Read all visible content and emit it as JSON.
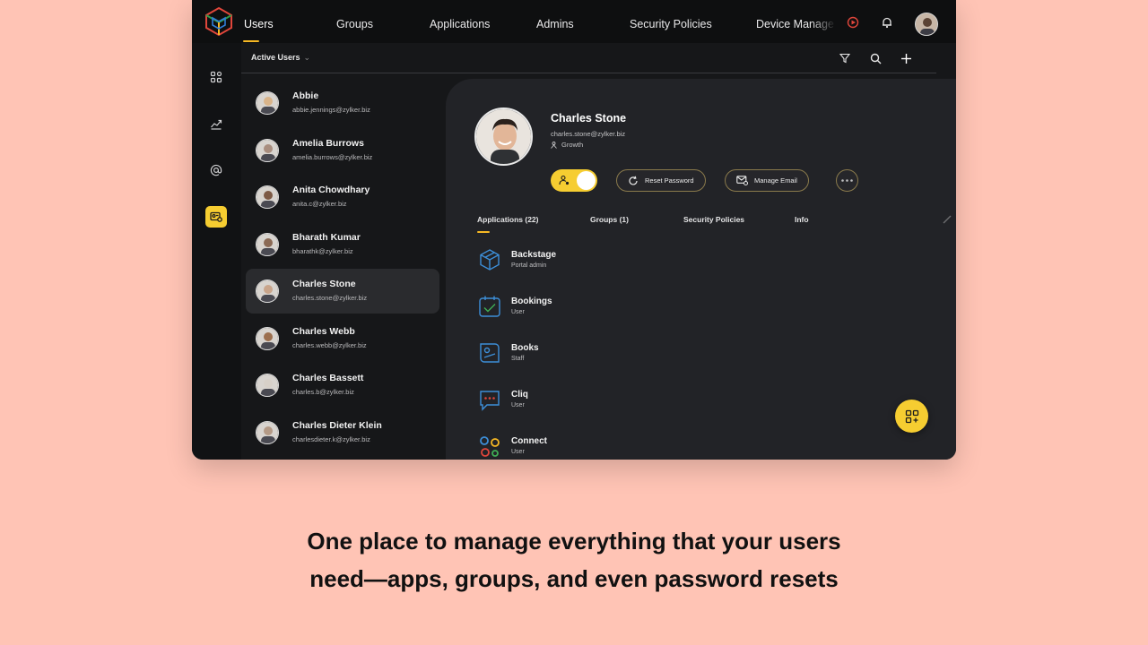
{
  "nav": {
    "tabs": [
      "Users",
      "Groups",
      "Applications",
      "Admins",
      "Security Policies",
      "Device Manage"
    ],
    "active_tab": "Users"
  },
  "subheader": {
    "filter_label": "Active Users"
  },
  "users": [
    {
      "name": "Abbie",
      "email": "abbie.jennings@zylker.biz",
      "avatar_color": "#d9b48a"
    },
    {
      "name": "Amelia Burrows",
      "email": "amelia.burrows@zylker.biz",
      "avatar_color": "#a98e7f"
    },
    {
      "name": "Anita Chowdhary",
      "email": "anita.c@zylker.biz",
      "avatar_color": "#7d5a45"
    },
    {
      "name": "Bharath Kumar",
      "email": "bharathk@zylker.biz",
      "avatar_color": "#8b6a55"
    },
    {
      "name": "Charles Stone",
      "email": "charles.stone@zylker.biz",
      "avatar_color": "#c9a58b"
    },
    {
      "name": "Charles Webb",
      "email": "charles.webb@zylker.biz",
      "avatar_color": "#9c6f4e"
    },
    {
      "name": "Charles Bassett",
      "email": "charles.b@zylker.biz",
      "avatar_color": "#d7d0c8"
    },
    {
      "name": "Charles Dieter Klein",
      "email": "charlesdieter.k@zylker.biz",
      "avatar_color": "#b49a86"
    }
  ],
  "selected_user_index": 4,
  "profile": {
    "name": "Charles Stone",
    "email": "charles.stone@zylker.biz",
    "department": "Growth",
    "reset_password_label": "Reset Password",
    "manage_email_label": "Manage Email"
  },
  "detail_tabs": [
    "Applications (22)",
    "Groups (1)",
    "Security Policies",
    "Info"
  ],
  "applications": [
    {
      "name": "Backstage",
      "role": "Portal admin",
      "icon": "backstage-icon"
    },
    {
      "name": "Bookings",
      "role": "User",
      "icon": "bookings-icon"
    },
    {
      "name": "Books",
      "role": "Staff",
      "icon": "books-icon"
    },
    {
      "name": "Cliq",
      "role": "User",
      "icon": "cliq-icon"
    },
    {
      "name": "Connect",
      "role": "User",
      "icon": "connect-icon"
    }
  ],
  "caption": {
    "line1": "One place to manage everything that your users",
    "line2": "need—apps, groups, and even password resets"
  },
  "colors": {
    "accent": "#f6cd31",
    "page_bg": "#ffc4b5",
    "app_icon": "#3d8fd9"
  }
}
